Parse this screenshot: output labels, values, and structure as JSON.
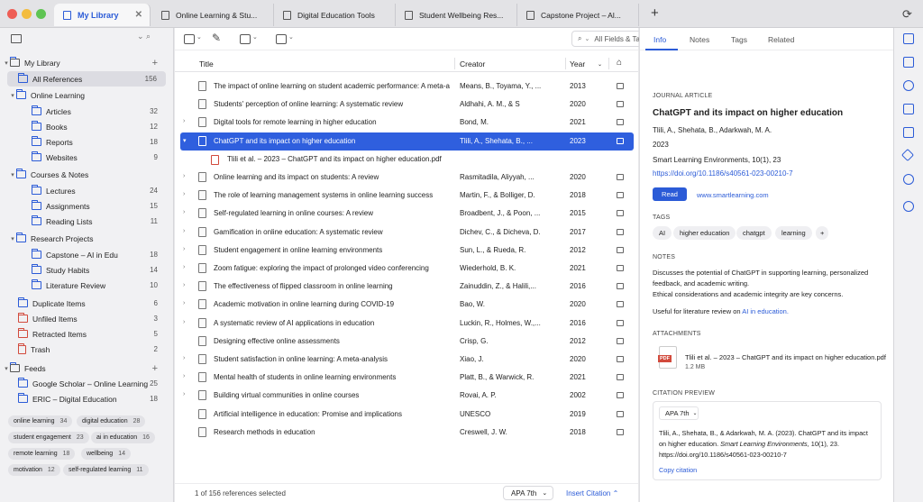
{
  "colors": {
    "accent": "#2b5bd7",
    "selected_row": "#2f5fde",
    "close": "#ee5d55",
    "minimize": "#f3bc3f",
    "zoom": "#5fc453"
  },
  "tabs": [
    {
      "label": "My Library",
      "active": true
    },
    {
      "label": "Online Learning & Stu..."
    },
    {
      "label": "Digital Education Tools"
    },
    {
      "label": "Student Wellbeing Res..."
    },
    {
      "label": "Capstone Project – Al..."
    }
  ],
  "sidebar": {
    "library_label": "My Library",
    "items": [
      {
        "label": "All References",
        "count": "156"
      },
      {
        "label": "Online Learning"
      },
      {
        "label": "Articles",
        "count": "32"
      },
      {
        "label": "Books",
        "count": "12"
      },
      {
        "label": "Reports",
        "count": "18"
      },
      {
        "label": "Websites",
        "count": "9"
      },
      {
        "label": "Courses & Notes"
      },
      {
        "label": "Lectures",
        "count": "24"
      },
      {
        "label": "Assignments",
        "count": "15"
      },
      {
        "label": "Reading Lists",
        "count": "11"
      },
      {
        "label": "Research Projects"
      },
      {
        "label": "Capstone – AI in Edu",
        "count": "18"
      },
      {
        "label": "Study Habits",
        "count": "14"
      },
      {
        "label": "Literature Review",
        "count": "10"
      },
      {
        "label": "Duplicate Items",
        "count": "6"
      },
      {
        "label": "Unfiled Items",
        "count": "3"
      },
      {
        "label": "Retracted Items",
        "count": "5"
      },
      {
        "label": "Trash",
        "count": "2"
      }
    ],
    "feeds_label": "Feeds",
    "feeds": [
      {
        "label": "Google Scholar – Online Learning",
        "count": "25"
      },
      {
        "label": "ERIC – Digital Education",
        "count": "18"
      }
    ],
    "tags": [
      {
        "label": "online learning",
        "count": "34"
      },
      {
        "label": "digital education",
        "count": "28"
      },
      {
        "label": "student engagement",
        "count": "23"
      },
      {
        "label": "ai in education",
        "count": "16"
      },
      {
        "label": "remote learning",
        "count": "18"
      },
      {
        "label": "wellbeing",
        "count": "14"
      },
      {
        "label": "motivation",
        "count": "12"
      },
      {
        "label": "self-regulated learning",
        "count": "11"
      }
    ]
  },
  "toolbar": {
    "search_placeholder": "All Fields & Tags"
  },
  "table": {
    "headers": {
      "title": "Title",
      "creator": "Creator",
      "year": "Year"
    },
    "rows": [
      {
        "title": "The impact of online learning on student academic performance: A meta-analysis",
        "creator": "Means, B., Toyama, Y., ...",
        "year": "2013"
      },
      {
        "title": "Students' perception of online learning: A systematic review",
        "creator": "Aldhahi, A. M., & S",
        "year": "2020"
      },
      {
        "title": "Digital tools for remote learning in higher education",
        "creator": "Bond, M.",
        "year": "2021"
      },
      {
        "title": "ChatGPT and its impact on higher education",
        "creator": "Tlili, A., Shehata, B., ...",
        "year": "2023"
      },
      {
        "title": "Tlili et al. – 2023 – ChatGPT and its impact on higher education.pdf",
        "creator": "",
        "year": ""
      },
      {
        "title": "Online learning and its impact on students: A review",
        "creator": "Rasmitadila, Aliyyah, ...",
        "year": "2020"
      },
      {
        "title": "The role of learning management systems in online learning success",
        "creator": "Martin, F., & Bolliger, D.",
        "year": "2018"
      },
      {
        "title": "Self-regulated learning in online courses: A review",
        "creator": "Broadbent, J., & Poon, ...",
        "year": "2015"
      },
      {
        "title": "Gamification in online education: A systematic review",
        "creator": "Dichev, C., & Dicheva, D.",
        "year": "2017"
      },
      {
        "title": "Student engagement in online learning environments",
        "creator": "Sun, L., & Rueda, R.",
        "year": "2012"
      },
      {
        "title": "Zoom fatigue: exploring the impact of prolonged video conferencing",
        "creator": "Wiederhold, B. K.",
        "year": "2021"
      },
      {
        "title": "The effectiveness of flipped classroom in online learning",
        "creator": "Zainuddin, Z., & Halili,...",
        "year": "2016"
      },
      {
        "title": "Academic motivation in online learning during COVID-19",
        "creator": "Bao, W.",
        "year": "2020"
      },
      {
        "title": "A systematic review of AI applications in education",
        "creator": "Luckin, R., Holmes, W.,...",
        "year": "2016"
      },
      {
        "title": "Designing effective online assessments",
        "creator": "Crisp, G.",
        "year": "2012"
      },
      {
        "title": "Student satisfaction in online learning: A meta-analysis",
        "creator": "Xiao, J.",
        "year": "2020"
      },
      {
        "title": "Mental health of students in online learning environments",
        "creator": "Platt, B., & Warwick, R.",
        "year": "2021"
      },
      {
        "title": "Building virtual communities in online courses",
        "creator": "Rovai, A. P.",
        "year": "2002"
      },
      {
        "title": "Artificial intelligence in education: Promise and implications",
        "creator": "UNESCO",
        "year": "2019"
      },
      {
        "title": "Research methods in education",
        "creator": "Creswell, J. W.",
        "year": "2018"
      }
    ]
  },
  "footer": {
    "status": "1 of 156 references selected",
    "style": "APA 7th",
    "insert": "Insert Citation"
  },
  "details": {
    "tabs": [
      "Info",
      "Notes",
      "Tags",
      "Related"
    ],
    "type": "JOURNAL ARTICLE",
    "title": "ChatGPT and its impact on higher education",
    "authors": "Tlili, A., Shehata, B., Adarkwah, M. A.",
    "year": "2023",
    "journal": "Smart Learning Environments, 10(1), 23",
    "doi": "https://doi.org/10.1186/s40561-023-00210-7",
    "read_label": "Read",
    "website": "www.smartlearning.com",
    "tags_label": "TAGS",
    "tags": [
      "AI",
      "higher education",
      "chatgpt",
      "learning"
    ],
    "notes_label": "NOTES",
    "notes": [
      "Discusses the potential of ChatGPT in supporting learning, personalized",
      "feedback, and academic writing.",
      "Ethical considerations and academic integrity are key concerns."
    ],
    "notes_useful": "Useful for literature review on",
    "notes_link": "AI in education.",
    "attachments_label": "ATTACHMENTS",
    "attachment_name": "Tlili et al. – 2023 – ChatGPT and its impact on higher education.pdf",
    "attachment_size": "1.2 MB",
    "pdf_badge": "PDF",
    "citation_label": "CITATION PREVIEW",
    "citation_style": "APA 7th",
    "citation_l1": "Tlili, A., Shehata, B., & Adarkwah, M. A. (2023). ChatGPT and its impact",
    "citation_l2a": "on higher education.",
    "citation_l2b": "Smart Learning Environments,",
    "citation_l2c": "10(1), 23.",
    "citation_l3": "https://doi.org/10.1186/s40561-023-00210-7",
    "copy_label": "Copy citation"
  }
}
